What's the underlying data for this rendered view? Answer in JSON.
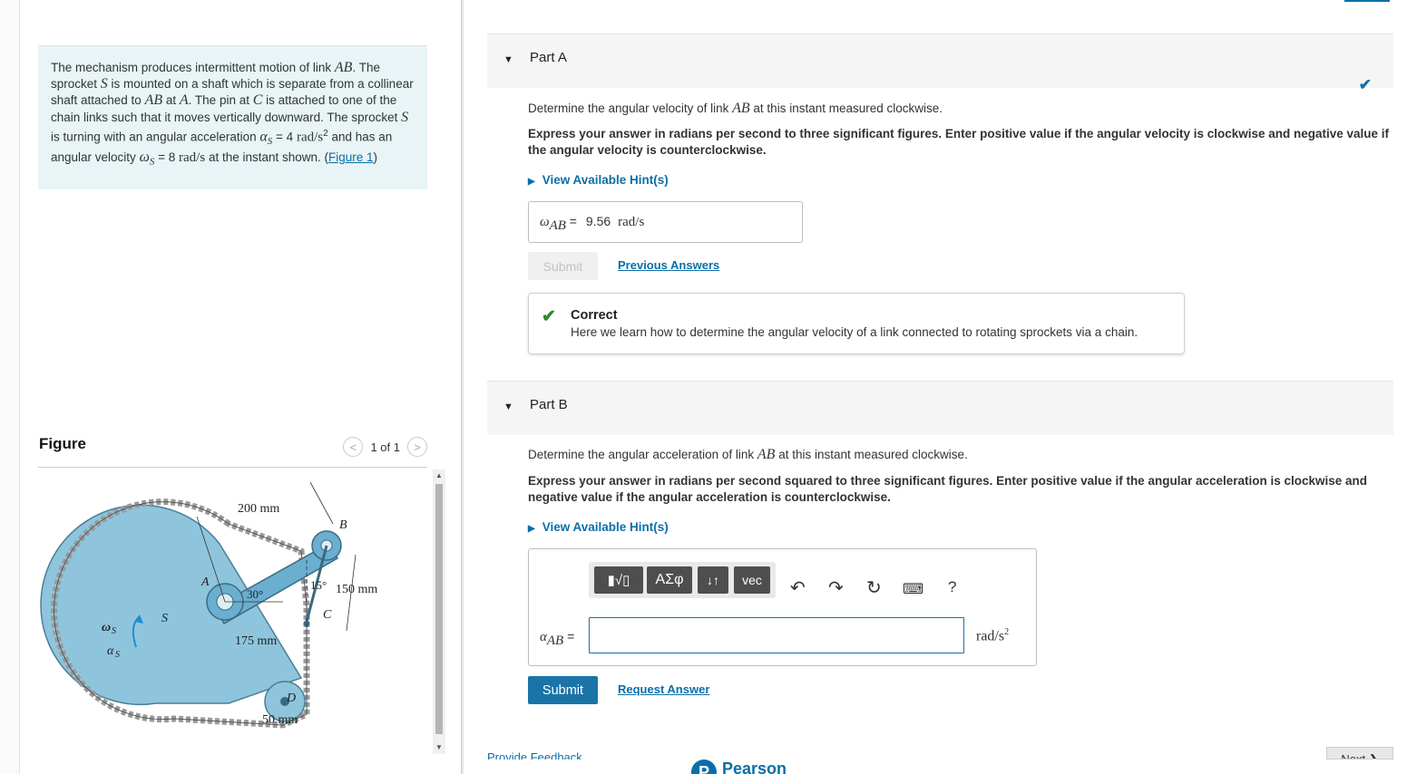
{
  "problem": {
    "t1": "The mechanism produces intermittent motion of link ",
    "AB": "AB",
    "t2": ". The sprocket ",
    "S": "S",
    "t3": " is mounted on a shaft which is separate from a collinear shaft attached to ",
    "t4": " at ",
    "A": "A",
    "t5": ". The pin at ",
    "C": "C",
    "t6": " is attached to one of the chain links such that it moves vertically downward. The sprocket ",
    "t7": " is turning with an angular acceleration ",
    "alpha_s": "α",
    "alpha_sub": "S",
    "alpha_val": " = 4 ",
    "alpha_unit": "rad/s",
    "alpha_sup": "2",
    "t8": " and has an angular velocity ",
    "omega_s": "ω",
    "omega_sub": "S",
    "omega_val": " = 8 ",
    "omega_unit": "rad/s",
    "t9": " at the instant shown. (",
    "figure_link": "Figure 1",
    "t10": ")"
  },
  "figure": {
    "title": "Figure",
    "pager": "1 of 1",
    "prev_glyph": "<",
    "next_glyph": ">",
    "labels": {
      "d200": "200 mm",
      "d150": "150 mm",
      "d175": "175 mm",
      "d50": "50 mm",
      "a30": "30°",
      "a15": "15°",
      "A": "A",
      "B": "B",
      "C": "C",
      "D": "D",
      "S": "S",
      "ws": "ω",
      "ws_sub": "S",
      "as": "α",
      "as_sub": "S"
    }
  },
  "partA": {
    "title": "Part A",
    "q1": "Determine the angular velocity of link ",
    "q_var": "AB",
    "q2": " at this instant measured clockwise.",
    "instr": "Express your answer in radians per second to three significant figures. Enter positive value if the angular velocity is clockwise and negative value if the angular velocity is counterclockwise.",
    "hint": "View Available Hint(s)",
    "ans_sym": "ω",
    "ans_sub": "AB",
    "ans_eq": " = ",
    "ans_val": "9.56",
    "ans_unit": "rad/s",
    "submit": "Submit",
    "prev_answers": "Previous Answers",
    "correct_title": "Correct",
    "correct_msg": "Here we learn how to determine the angular velocity of a link connected to rotating sprockets via a chain."
  },
  "partB": {
    "title": "Part B",
    "q1": "Determine the angular acceleration of link ",
    "q_var": "AB",
    "q2": " at this instant measured clockwise.",
    "instr": "Express your answer in radians per second squared to three significant figures. Enter positive value if the angular acceleration is clockwise and negative value if the angular acceleration is counterclockwise.",
    "hint": "View Available Hint(s)",
    "toolbar": {
      "templates": "▮√▯",
      "greek": "ΑΣφ",
      "arrows": "↓↑",
      "vec": "vec"
    },
    "ans_sym": "α",
    "ans_sub": "AB",
    "ans_eq": " =",
    "ans_unit": "rad/s",
    "ans_unit_sup": "2",
    "submit": "Submit",
    "request": "Request Answer"
  },
  "footer": {
    "feedback": "Provide Feedback",
    "next": "Next ❯",
    "brand": "Pearson",
    "brand_glyph": "P"
  }
}
